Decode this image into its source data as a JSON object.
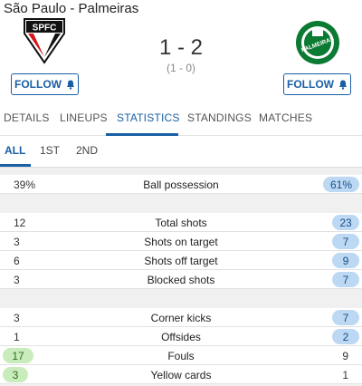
{
  "match": {
    "title": "São Paulo - Palmeiras",
    "score": "1 - 2",
    "halftime": "(1 - 0)",
    "home_logo_text": "SPFC",
    "away_logo_text": "PALMEIRAS",
    "follow_label": "FOLLOW"
  },
  "tabs": [
    {
      "label": "DETAILS"
    },
    {
      "label": "LINEUPS"
    },
    {
      "label": "STATISTICS",
      "active": true
    },
    {
      "label": "STANDINGS"
    },
    {
      "label": "MATCHES"
    }
  ],
  "periods": [
    {
      "label": "ALL",
      "active": true
    },
    {
      "label": "1ST"
    },
    {
      "label": "2ND"
    }
  ],
  "stats": [
    {
      "label": "Ball possession",
      "home": "39%",
      "away": "61%",
      "winner": "away"
    },
    {
      "label": "Total shots",
      "home": "12",
      "away": "23",
      "winner": "away"
    },
    {
      "label": "Shots on target",
      "home": "3",
      "away": "7",
      "winner": "away"
    },
    {
      "label": "Shots off target",
      "home": "6",
      "away": "9",
      "winner": "away"
    },
    {
      "label": "Blocked shots",
      "home": "3",
      "away": "7",
      "winner": "away"
    },
    {
      "label": "Corner kicks",
      "home": "3",
      "away": "7",
      "winner": "away"
    },
    {
      "label": "Offsides",
      "home": "1",
      "away": "2",
      "winner": "away"
    },
    {
      "label": "Fouls",
      "home": "17",
      "away": "9",
      "winner": "home"
    },
    {
      "label": "Yellow cards",
      "home": "3",
      "away": "1",
      "winner": "home"
    }
  ],
  "icons": {
    "bell": "bell-icon",
    "home_logo": "sao-paulo-crest-icon",
    "away_logo": "palmeiras-crest-icon"
  },
  "colors": {
    "accent": "#1a5fa3",
    "away_highlight": "#bcd8f2",
    "home_highlight": "#c9ecbc"
  }
}
